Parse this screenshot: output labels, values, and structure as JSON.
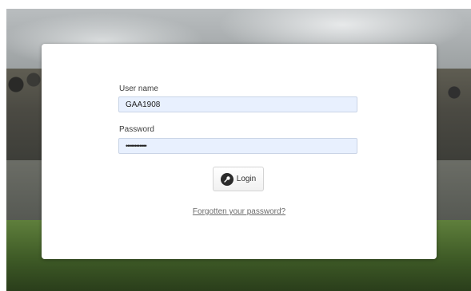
{
  "login_form": {
    "username_label": "User name",
    "username_value": "GAA1908",
    "password_label": "Password",
    "password_value": "••••••••••••",
    "login_button_label": "Login",
    "login_icon": "key-icon",
    "forgot_password_link": "Forgotten your password?"
  },
  "colors": {
    "input_background": "#e8f0fe",
    "card_background": "#ffffff",
    "link_text": "#6b6b6b"
  }
}
